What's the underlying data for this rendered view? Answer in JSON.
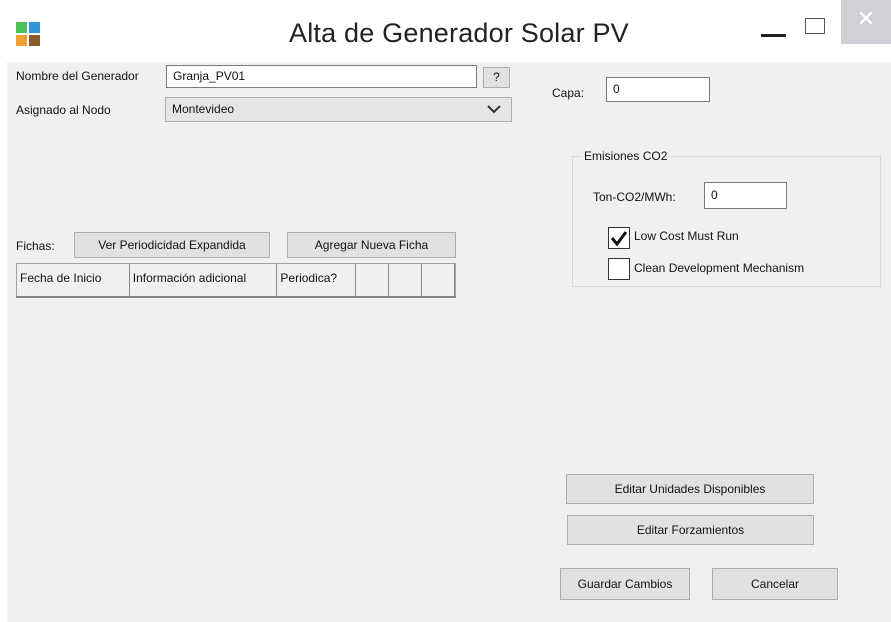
{
  "window": {
    "title": "Alta de Generador Solar PV",
    "close_glyph": "✕",
    "icon_colors": [
      "#4cc35a",
      "#2f97d9",
      "#f0a030",
      "#8a5a2b"
    ]
  },
  "form": {
    "nombre_label": "Nombre del Generador",
    "nombre_value": "Granja_PV01",
    "help_label": "?",
    "nodo_label": "Asignado al Nodo",
    "nodo_value": "Montevideo",
    "capa_label": "Capa:",
    "capa_value": "0"
  },
  "emisiones": {
    "title": "Emisiones CO2",
    "ton_label": "Ton-CO2/MWh:",
    "ton_value": "0",
    "lcmr_label": "Low Cost Must Run",
    "lcmr_checked": true,
    "cdm_label": "Clean Development Mechanism",
    "cdm_checked": false
  },
  "fichas": {
    "label": "Fichas:",
    "ver_button": "Ver Periodicidad Expandida",
    "agregar_button": "Agregar Nueva Ficha",
    "columns": [
      "Fecha de Inicio",
      "Información adicional",
      "Periodica?",
      "",
      "",
      "",
      ""
    ]
  },
  "actions": {
    "editar_unidades": "Editar Unidades Disponibles",
    "editar_forzamientos": "Editar Forzamientos",
    "guardar": "Guardar Cambios",
    "cancelar": "Cancelar"
  }
}
